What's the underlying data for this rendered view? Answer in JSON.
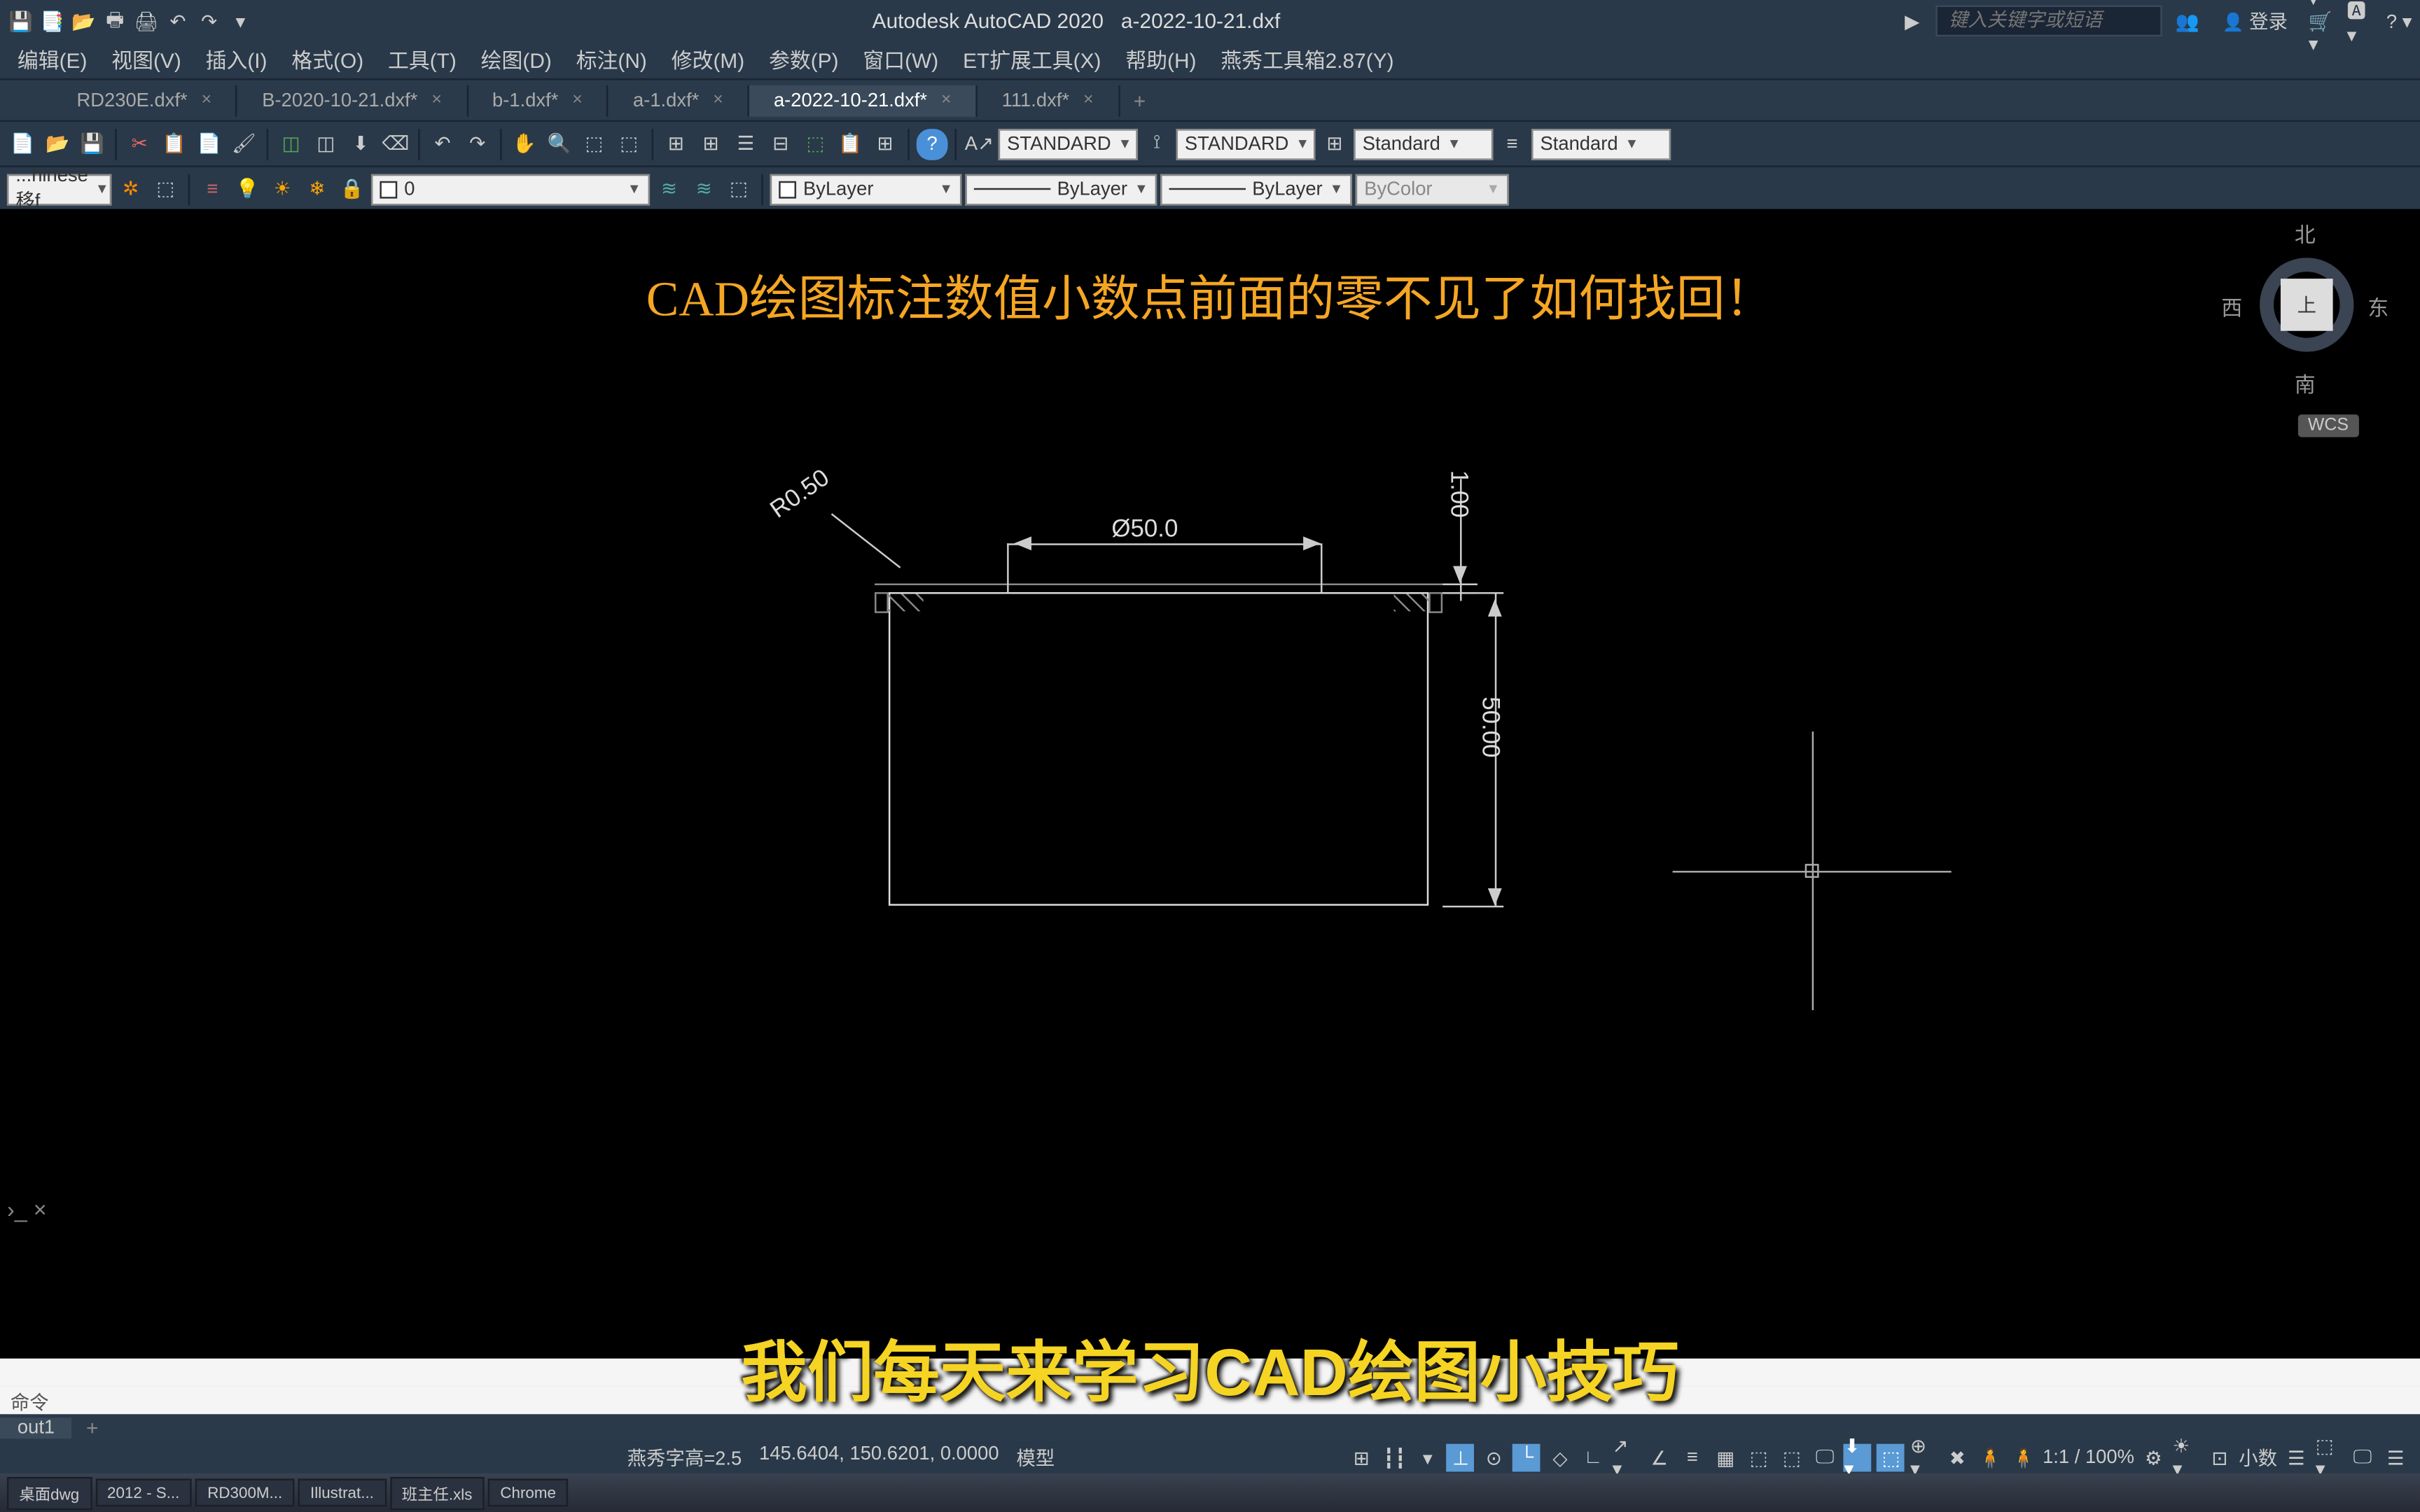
{
  "app": {
    "name": "Autodesk AutoCAD 2020",
    "filename": "a-2022-10-21.dxf",
    "search_placeholder": "键入关键字或短语",
    "login": "登录"
  },
  "menu": [
    "编辑(E)",
    "视图(V)",
    "插入(I)",
    "格式(O)",
    "工具(T)",
    "绘图(D)",
    "标注(N)",
    "修改(M)",
    "参数(P)",
    "窗口(W)",
    "ET扩展工具(X)",
    "帮助(H)",
    "燕秀工具箱2.87(Y)"
  ],
  "tabs": [
    {
      "label": "RD230E.dxf*",
      "active": false
    },
    {
      "label": "B-2020-10-21.dxf*",
      "active": false
    },
    {
      "label": "b-1.dxf*",
      "active": false
    },
    {
      "label": "a-1.dxf*",
      "active": false
    },
    {
      "label": "a-2022-10-21.dxf*",
      "active": true
    },
    {
      "label": "111.dxf*",
      "active": false
    }
  ],
  "toolbar": {
    "text_style": "STANDARD",
    "dim_style": "STANDARD",
    "table_style": "Standard",
    "ml_style": "Standard",
    "layer_combo": "...hinese 移f",
    "layer_num": "0",
    "color": "ByLayer",
    "linetype": "ByLayer",
    "lineweight": "ByLayer",
    "plotstyle": "ByColor"
  },
  "canvas": {
    "title_overlay": "CAD绘图标注数值小数点前面的零不见了如何找回！",
    "subtitle_overlay": "我们每天来学习CAD绘图小技巧",
    "dims": {
      "radius": "R0.50",
      "diameter": "Ø50.0",
      "height": "50.00",
      "thickness": "1.00"
    }
  },
  "viewcube": {
    "north": "北",
    "south": "南",
    "east": "东",
    "west": "西",
    "top": "上",
    "wcs": "WCS"
  },
  "command": {
    "prompt": "命令",
    "handle": "›_ ×"
  },
  "layout": {
    "tab": "out1"
  },
  "statusbar": {
    "yanxiu": "燕秀字高=2.5",
    "coords": "145.6404, 150.6201, 0.0000",
    "model": "模型",
    "scale": "1:1 / 100%",
    "decimal": "小数"
  },
  "taskbar": [
    "桌面dwg",
    "2012 - S...",
    "RD300M...",
    "Illustrat...",
    "班主任.xls",
    "Chrome"
  ]
}
